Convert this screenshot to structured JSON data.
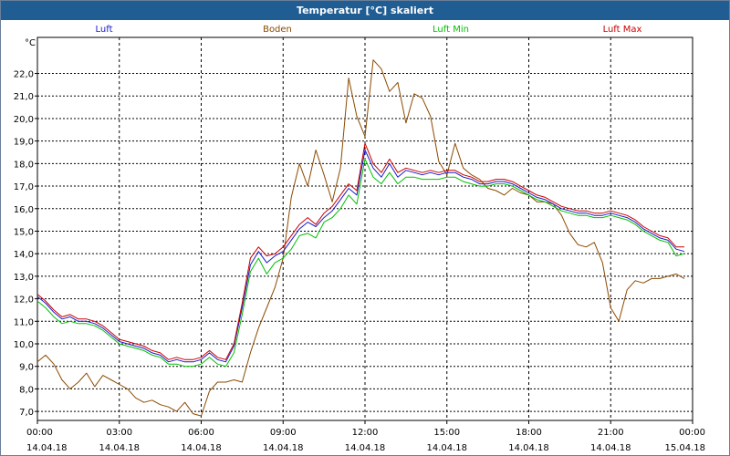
{
  "window": {
    "title": "Temperatur [°C] skaliert"
  },
  "chart_data": {
    "type": "line",
    "title": "Temperatur [°C] skaliert",
    "ylabel": "°C",
    "xlabel": "",
    "ylim": [
      6.6,
      23.6
    ],
    "xlim": [
      0,
      24
    ],
    "grid": true,
    "legend_position": "top",
    "y_ticks": [
      7.0,
      8.0,
      9.0,
      10.0,
      11.0,
      12.0,
      13.0,
      14.0,
      15.0,
      16.0,
      17.0,
      18.0,
      19.0,
      20.0,
      21.0,
      22.0
    ],
    "y_tick_labels": [
      "7,0",
      "8,0",
      "9,0",
      "10,0",
      "11,0",
      "12,0",
      "13,0",
      "14,0",
      "15,0",
      "16,0",
      "17,0",
      "18,0",
      "19,0",
      "20,0",
      "21,0",
      "22,0"
    ],
    "x_ticks": [
      0,
      3,
      6,
      9,
      12,
      15,
      18,
      21,
      24
    ],
    "x_tick_times": [
      "00:00",
      "03:00",
      "06:00",
      "09:00",
      "12:00",
      "15:00",
      "18:00",
      "21:00",
      "00:00"
    ],
    "x_tick_dates": [
      "14.04.18",
      "14.04.18",
      "14.04.18",
      "14.04.18",
      "14.04.18",
      "14.04.18",
      "14.04.18",
      "14.04.18",
      "15.04.18"
    ],
    "series": [
      {
        "name": "Boden",
        "color": "#8b4a00",
        "x": [
          0,
          0.3,
          0.6,
          0.9,
          1.2,
          1.5,
          1.8,
          2.1,
          2.4,
          2.7,
          3.0,
          3.3,
          3.6,
          3.9,
          4.2,
          4.5,
          4.8,
          5.1,
          5.4,
          5.7,
          6.0,
          6.3,
          6.6,
          6.9,
          7.2,
          7.5,
          7.8,
          8.1,
          8.4,
          8.7,
          9.0,
          9.3,
          9.6,
          9.9,
          10.2,
          10.5,
          10.8,
          11.1,
          11.4,
          11.7,
          12.0,
          12.3,
          12.6,
          12.9,
          13.2,
          13.5,
          13.8,
          14.1,
          14.4,
          14.7,
          15.0,
          15.3,
          15.6,
          15.9,
          16.2,
          16.5,
          16.8,
          17.1,
          17.4,
          17.7,
          18.0,
          18.3,
          18.6,
          18.9,
          19.2,
          19.5,
          19.8,
          20.1,
          20.4,
          20.7,
          21.0,
          21.3,
          21.6,
          21.9,
          22.2,
          22.5,
          22.8,
          23.1,
          23.4,
          23.7
        ],
        "values": [
          9.2,
          9.5,
          9.1,
          8.4,
          8.0,
          8.3,
          8.7,
          8.1,
          8.6,
          8.4,
          8.2,
          8.0,
          7.6,
          7.4,
          7.5,
          7.3,
          7.2,
          7.0,
          7.4,
          6.9,
          6.8,
          7.9,
          8.3,
          8.3,
          8.4,
          8.3,
          9.6,
          10.7,
          11.6,
          12.5,
          13.8,
          16.5,
          18.0,
          17.0,
          18.6,
          17.5,
          16.3,
          17.8,
          21.8,
          20.1,
          19.2,
          22.6,
          22.2,
          21.2,
          21.6,
          19.8,
          21.1,
          20.9,
          20.1,
          18.1,
          17.5,
          18.9,
          17.8,
          17.5,
          17.3,
          16.9,
          16.8,
          16.6,
          16.9,
          16.7,
          16.6,
          16.3,
          16.3,
          16.2,
          15.7,
          14.9,
          14.4,
          14.3,
          14.5,
          13.6,
          11.6,
          11.0,
          12.4,
          12.8,
          12.7,
          12.9,
          12.9,
          13.0,
          13.1,
          12.9
        ]
      },
      {
        "name": "Luft",
        "color": "#1a1acc",
        "x": [
          0,
          0.3,
          0.6,
          0.9,
          1.2,
          1.5,
          1.8,
          2.1,
          2.4,
          2.7,
          3.0,
          3.3,
          3.6,
          3.9,
          4.2,
          4.5,
          4.8,
          5.1,
          5.4,
          5.7,
          6.0,
          6.3,
          6.6,
          6.9,
          7.2,
          7.5,
          7.8,
          8.1,
          8.4,
          8.7,
          9.0,
          9.3,
          9.6,
          9.9,
          10.2,
          10.5,
          10.8,
          11.1,
          11.4,
          11.7,
          12.0,
          12.3,
          12.6,
          12.9,
          13.2,
          13.5,
          13.8,
          14.1,
          14.4,
          14.7,
          15.0,
          15.3,
          15.6,
          15.9,
          16.2,
          16.5,
          16.8,
          17.1,
          17.4,
          17.7,
          18.0,
          18.3,
          18.6,
          18.9,
          19.2,
          19.5,
          19.8,
          20.1,
          20.4,
          20.7,
          21.0,
          21.3,
          21.6,
          21.9,
          22.2,
          22.5,
          22.8,
          23.1,
          23.4,
          23.7
        ],
        "values": [
          12.1,
          11.8,
          11.4,
          11.1,
          11.2,
          11.0,
          11.0,
          10.9,
          10.7,
          10.4,
          10.1,
          10.0,
          9.9,
          9.8,
          9.6,
          9.5,
          9.2,
          9.3,
          9.2,
          9.2,
          9.3,
          9.6,
          9.3,
          9.2,
          9.9,
          11.6,
          13.5,
          14.1,
          13.6,
          13.9,
          14.1,
          14.6,
          15.1,
          15.4,
          15.2,
          15.6,
          15.9,
          16.4,
          16.9,
          16.6,
          18.6,
          17.8,
          17.4,
          18.0,
          17.4,
          17.7,
          17.6,
          17.5,
          17.6,
          17.5,
          17.6,
          17.6,
          17.4,
          17.3,
          17.1,
          17.1,
          17.2,
          17.2,
          17.1,
          16.9,
          16.7,
          16.5,
          16.4,
          16.2,
          16.0,
          15.9,
          15.8,
          15.8,
          15.7,
          15.7,
          15.8,
          15.7,
          15.6,
          15.4,
          15.1,
          14.9,
          14.7,
          14.6,
          14.2,
          14.1
        ]
      },
      {
        "name": "Luft Min",
        "color": "#00c000",
        "x": [
          0,
          0.3,
          0.6,
          0.9,
          1.2,
          1.5,
          1.8,
          2.1,
          2.4,
          2.7,
          3.0,
          3.3,
          3.6,
          3.9,
          4.2,
          4.5,
          4.8,
          5.1,
          5.4,
          5.7,
          6.0,
          6.3,
          6.6,
          6.9,
          7.2,
          7.5,
          7.8,
          8.1,
          8.4,
          8.7,
          9.0,
          9.3,
          9.6,
          9.9,
          10.2,
          10.5,
          10.8,
          11.1,
          11.4,
          11.7,
          12.0,
          12.3,
          12.6,
          12.9,
          13.2,
          13.5,
          13.8,
          14.1,
          14.4,
          14.7,
          15.0,
          15.3,
          15.6,
          15.9,
          16.2,
          16.5,
          16.8,
          17.1,
          17.4,
          17.7,
          18.0,
          18.3,
          18.6,
          18.9,
          19.2,
          19.5,
          19.8,
          20.1,
          20.4,
          20.7,
          21.0,
          21.3,
          21.6,
          21.9,
          22.2,
          22.5,
          22.8,
          23.1,
          23.4,
          23.7
        ],
        "values": [
          11.9,
          11.6,
          11.2,
          10.9,
          11.0,
          10.9,
          10.9,
          10.8,
          10.6,
          10.3,
          10.0,
          9.9,
          9.8,
          9.7,
          9.5,
          9.4,
          9.1,
          9.1,
          9.0,
          9.0,
          9.1,
          9.4,
          9.1,
          9.0,
          9.6,
          11.3,
          13.2,
          13.8,
          13.1,
          13.6,
          13.8,
          14.2,
          14.8,
          14.9,
          14.7,
          15.4,
          15.6,
          16.0,
          16.6,
          16.2,
          18.2,
          17.4,
          17.1,
          17.6,
          17.1,
          17.4,
          17.4,
          17.3,
          17.3,
          17.3,
          17.4,
          17.4,
          17.2,
          17.1,
          17.0,
          17.0,
          17.1,
          17.1,
          17.0,
          16.8,
          16.6,
          16.4,
          16.3,
          16.1,
          15.9,
          15.8,
          15.7,
          15.7,
          15.6,
          15.6,
          15.7,
          15.6,
          15.5,
          15.3,
          15.0,
          14.8,
          14.6,
          14.5,
          13.9,
          14.0
        ]
      },
      {
        "name": "Luft Max",
        "color": "#cc0000",
        "x": [
          0,
          0.3,
          0.6,
          0.9,
          1.2,
          1.5,
          1.8,
          2.1,
          2.4,
          2.7,
          3.0,
          3.3,
          3.6,
          3.9,
          4.2,
          4.5,
          4.8,
          5.1,
          5.4,
          5.7,
          6.0,
          6.3,
          6.6,
          6.9,
          7.2,
          7.5,
          7.8,
          8.1,
          8.4,
          8.7,
          9.0,
          9.3,
          9.6,
          9.9,
          10.2,
          10.5,
          10.8,
          11.1,
          11.4,
          11.7,
          12.0,
          12.3,
          12.6,
          12.9,
          13.2,
          13.5,
          13.8,
          14.1,
          14.4,
          14.7,
          15.0,
          15.3,
          15.6,
          15.9,
          16.2,
          16.5,
          16.8,
          17.1,
          17.4,
          17.7,
          18.0,
          18.3,
          18.6,
          18.9,
          19.2,
          19.5,
          19.8,
          20.1,
          20.4,
          20.7,
          21.0,
          21.3,
          21.6,
          21.9,
          22.2,
          22.5,
          22.8,
          23.1,
          23.4,
          23.7
        ],
        "values": [
          12.2,
          11.9,
          11.5,
          11.2,
          11.3,
          11.1,
          11.1,
          11.0,
          10.8,
          10.5,
          10.2,
          10.1,
          10.0,
          9.9,
          9.7,
          9.6,
          9.3,
          9.4,
          9.3,
          9.3,
          9.4,
          9.7,
          9.4,
          9.3,
          10.0,
          11.8,
          13.8,
          14.3,
          13.9,
          14.0,
          14.3,
          14.8,
          15.3,
          15.6,
          15.3,
          15.8,
          16.1,
          16.6,
          17.1,
          16.8,
          18.9,
          18.0,
          17.6,
          18.2,
          17.6,
          17.8,
          17.7,
          17.6,
          17.7,
          17.6,
          17.7,
          17.7,
          17.5,
          17.4,
          17.2,
          17.2,
          17.3,
          17.3,
          17.2,
          17.0,
          16.8,
          16.6,
          16.5,
          16.3,
          16.1,
          16.0,
          15.9,
          15.9,
          15.8,
          15.8,
          15.9,
          15.8,
          15.7,
          15.5,
          15.2,
          15.0,
          14.8,
          14.7,
          14.3,
          14.3
        ]
      }
    ]
  }
}
